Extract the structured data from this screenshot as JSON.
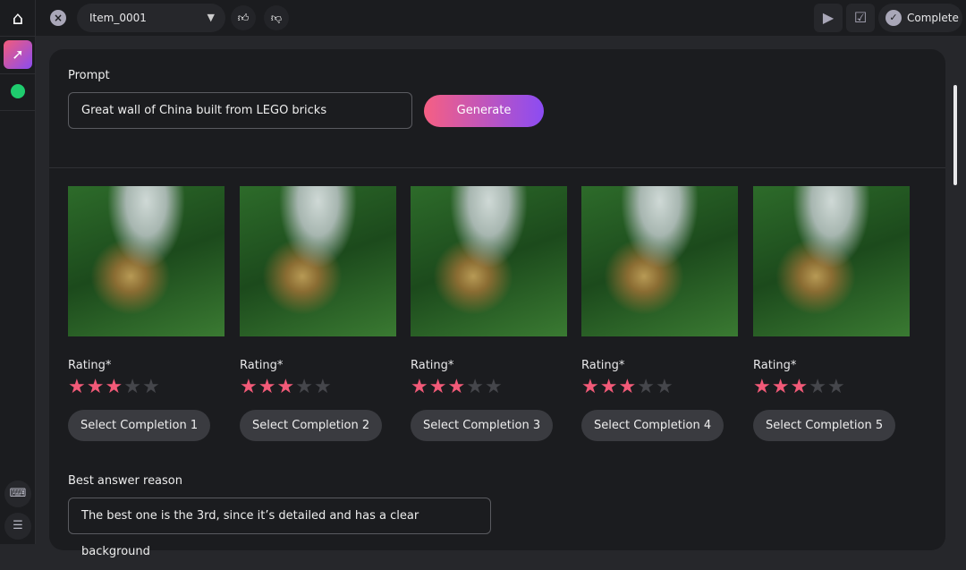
{
  "topbar": {
    "item": "Item_0001",
    "complete_label": "Complete"
  },
  "prompt": {
    "label": "Prompt",
    "value": "Great wall of China built from LEGO bricks",
    "generate_label": "Generate"
  },
  "completions": [
    {
      "rating_label": "Rating*",
      "rating": 3,
      "max": 5,
      "select_label": "Select Completion 1"
    },
    {
      "rating_label": "Rating*",
      "rating": 3,
      "max": 5,
      "select_label": "Select Completion 2"
    },
    {
      "rating_label": "Rating*",
      "rating": 3,
      "max": 5,
      "select_label": "Select Completion 3"
    },
    {
      "rating_label": "Rating*",
      "rating": 3,
      "max": 5,
      "select_label": "Select Completion 4"
    },
    {
      "rating_label": "Rating*",
      "rating": 3,
      "max": 5,
      "select_label": "Select Completion 5"
    }
  ],
  "reason": {
    "label": "Best answer reason",
    "value": "The best one is the 3rd, since it’s detailed and has a clear background"
  },
  "colors": {
    "accent_start": "#f65f83",
    "accent_end": "#8b4cf3",
    "star_on": "#f25a78",
    "status_green": "#1fcc6e"
  }
}
